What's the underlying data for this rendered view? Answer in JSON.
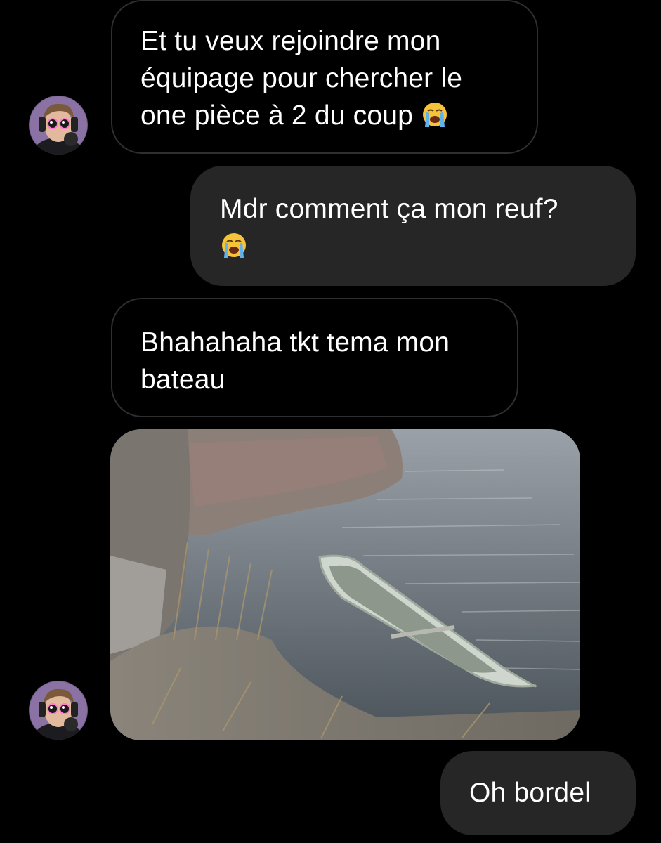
{
  "conversation": {
    "messages": [
      {
        "sender": "them",
        "text": "Et tu veux rejoindre mon\néquipage pour chercher le\none pièce à 2 du coup ",
        "emoji": "loudly-crying-face"
      },
      {
        "sender": "me",
        "text": "Mdr comment ça mon reuf?\n",
        "emoji": "loudly-crying-face"
      },
      {
        "sender": "them",
        "text": "Bhahahaha tkt tema mon\nbateau"
      },
      {
        "sender": "them",
        "type": "image",
        "image": "half-sunken-rowboat-by-riverbank"
      },
      {
        "sender": "me",
        "text": "Oh bordel"
      }
    ]
  },
  "colors": {
    "background": "#000000",
    "incoming_border": "#2f2f2f",
    "outgoing_bubble": "#262626",
    "text": "#ffffff"
  }
}
